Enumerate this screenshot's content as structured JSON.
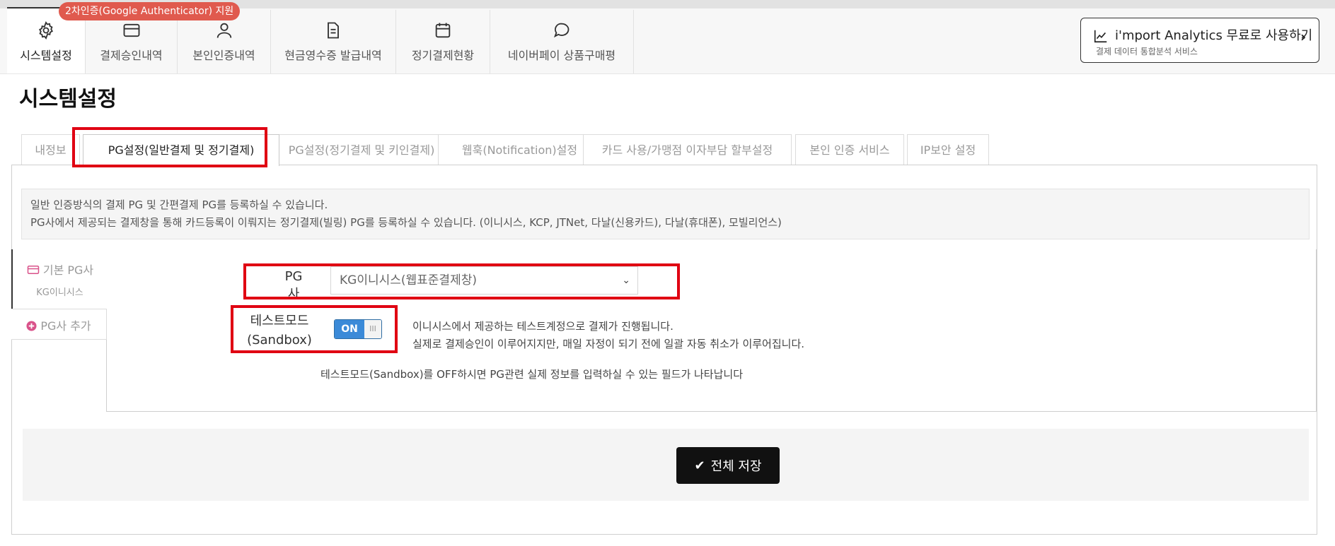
{
  "badge": {
    "text": "2차인증(Google Authenticator) 지원"
  },
  "nav": {
    "items": [
      {
        "label": "시스템설정",
        "icon": "gear-icon"
      },
      {
        "label": "결제승인내역",
        "icon": "card-icon"
      },
      {
        "label": "본인인증내역",
        "icon": "user-icon"
      },
      {
        "label": "현금영수증 발급내역",
        "icon": "document-icon"
      },
      {
        "label": "정기결제현황",
        "icon": "calendar-icon"
      },
      {
        "label": "네이버페이 상품구매평",
        "icon": "chat-bubble-icon"
      }
    ]
  },
  "analytics": {
    "title": "i'mport Analytics 무료로 사용하기",
    "subtitle": "결제 데이터 통합분석 서비스"
  },
  "page": {
    "title": "시스템설정"
  },
  "tabs": [
    {
      "label": "내정보"
    },
    {
      "label": "PG설정(일반결제 및 정기결제)"
    },
    {
      "label": "PG설정(정기결제 및 키인결제)"
    },
    {
      "label": "웹훅(Notification)설정"
    },
    {
      "label": "카드 사용/가맹점 이자부담 할부설정"
    },
    {
      "label": "본인 인증 서비스"
    },
    {
      "label": "IP보안 설정"
    }
  ],
  "info": {
    "line1": "일반 인증방식의 결제 PG 및 간편결제 PG를 등록하실 수 있습니다.",
    "line2": "PG사에서 제공되는 결제창을 통해 카드등록이 이뤄지는 정기결제(빌링) PG를 등록하실 수 있습니다. (이니시스, KCP, JTNet, 다날(신용카드), 다날(휴대폰), 모빌리언스)"
  },
  "side": {
    "primary_label": "기본 PG사",
    "primary_sub": "KG이니시스",
    "add_label": "PG사 추가"
  },
  "form": {
    "pg_label": "PG사",
    "pg_value": "KG이니시스(웹표준결제창)",
    "test_label_1": "테스트모드",
    "test_label_2": "(Sandbox)",
    "toggle_on": "ON",
    "toggle_grip": "III",
    "desc1": "이니시스에서 제공하는 테스트계정으로 결제가 진행됩니다.",
    "desc2": "실제로 결제승인이 이루어지지만, 매일 자정이 되기 전에 일괄 자동 취소가 이루어집니다.",
    "note": "테스트모드(Sandbox)를 OFF하시면 PG관련 실제 정보를 입력하실 수 있는 필드가 나타납니다"
  },
  "save": {
    "label": "전체 저장"
  },
  "colors": {
    "highlight": "#e00012",
    "toggle_on": "#3b8ad8",
    "badge": "#e05a4e"
  }
}
